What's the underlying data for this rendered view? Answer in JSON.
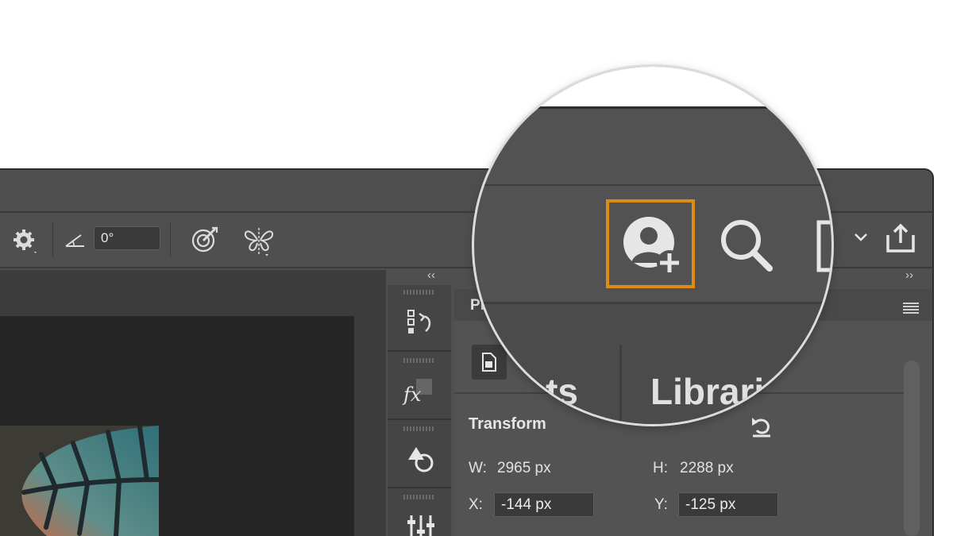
{
  "toolbar": {
    "angle_value": "0°",
    "icons": [
      "gear-icon",
      "angle-icon",
      "target-brush-icon",
      "symmetry-butterfly-icon"
    ]
  },
  "panels": {
    "collapse_left_label": "‹‹",
    "collapse_right_label": "››",
    "properties_tab_partial": "Pr",
    "transform": {
      "heading": "Transform",
      "w_label": "W:",
      "w_value": "2965 px",
      "h_label": "H:",
      "h_value": "2288 px",
      "x_label": "X:",
      "x_value": "-144 px",
      "y_label": "Y:",
      "y_value": "-125 px"
    }
  },
  "magnifier": {
    "tab_adjustments_partial": "nts",
    "tab_libraries_partial": "Librari",
    "highlight_color": "#e08a17",
    "icons": [
      "invite-user-icon",
      "search-icon",
      "arrange-documents-icon",
      "chevron-down-icon",
      "share-icon"
    ]
  }
}
